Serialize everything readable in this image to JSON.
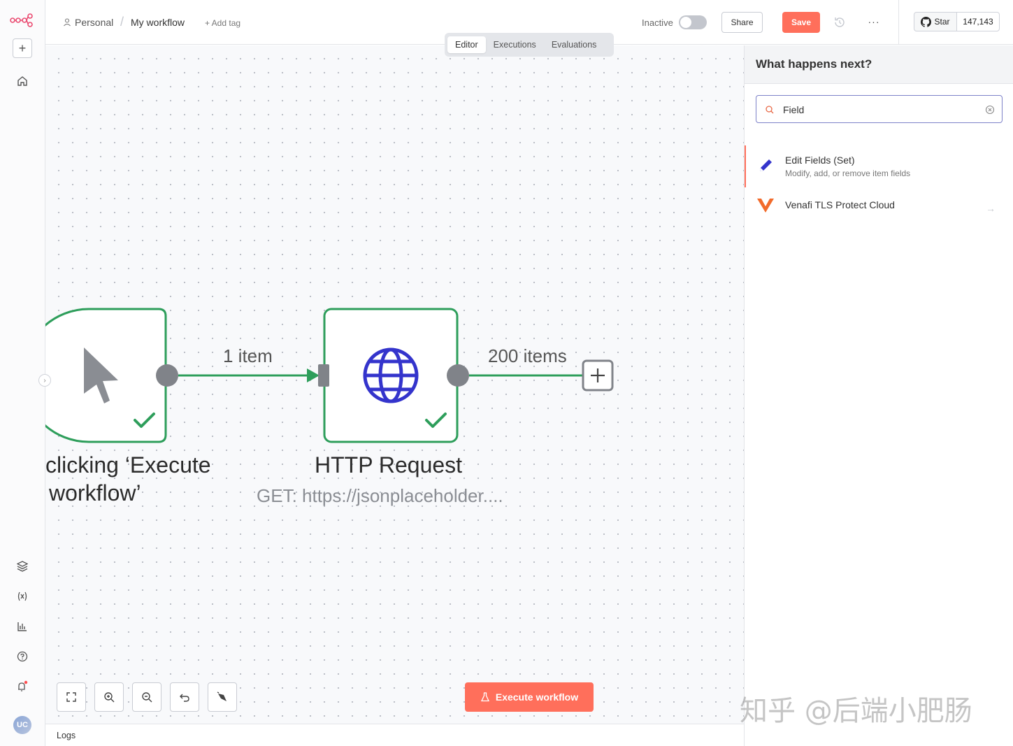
{
  "header": {
    "breadcrumb_personal": "Personal",
    "breadcrumb_sep": "/",
    "workflow_name": "My workflow",
    "add_tag": "+ Add tag",
    "status_label": "Inactive",
    "share_label": "Share",
    "save_label": "Save",
    "more_label": "···"
  },
  "github": {
    "star_label": "Star",
    "star_count": "147,143"
  },
  "tabs": [
    {
      "label": "Editor",
      "active": true
    },
    {
      "label": "Executions",
      "active": false
    },
    {
      "label": "Evaluations",
      "active": false
    }
  ],
  "canvas": {
    "trigger_node": {
      "label_line1": "clicking ‘Execute",
      "label_line2": "workflow’"
    },
    "edge1_label": "1 item",
    "http_node": {
      "label": "HTTP Request",
      "subtitle": "GET: https://jsonplaceholder...."
    },
    "edge2_label": "200 items",
    "execute_label": "Execute workflow"
  },
  "logs": {
    "label": "Logs"
  },
  "sidebar": {
    "avatar_initials": "UC",
    "collapse_glyph": "›"
  },
  "panel": {
    "title": "What happens next?",
    "search_value": "Field",
    "results": [
      {
        "title": "Edit Fields (Set)",
        "description": "Modify, add, or remove item fields",
        "icon": "pencil-icon"
      },
      {
        "title": "Venafi TLS Protect Cloud",
        "description": "",
        "icon": "venafi-logo-icon",
        "arrow": "→"
      }
    ]
  },
  "watermark": "知乎 @后端小肥肠",
  "colors": {
    "accent": "#ff6f5b",
    "success": "#2e9e5b",
    "node_icon_blue": "#3434cc",
    "search_border": "#7d82c9"
  }
}
